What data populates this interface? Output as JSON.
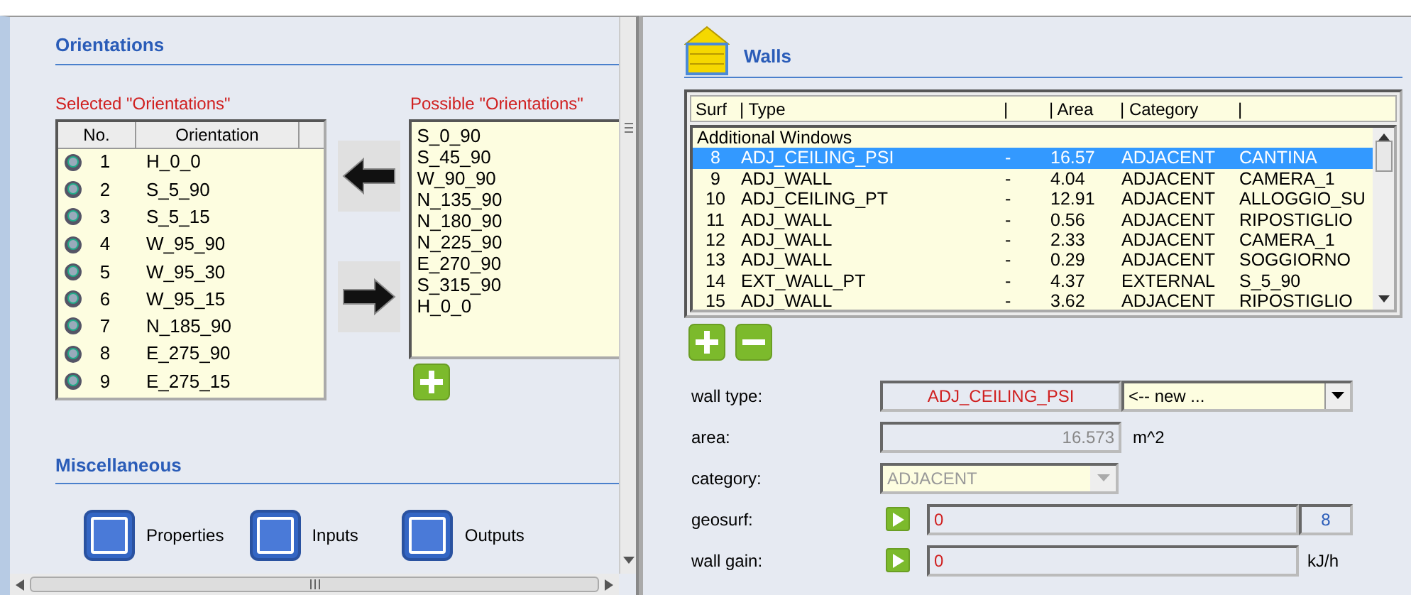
{
  "orientations": {
    "title": "Orientations",
    "selected_label": "Selected \"Orientations\"",
    "possible_label": "Possible \"Orientations\"",
    "columns": [
      "No.",
      "Orientation"
    ],
    "rows": [
      {
        "no": "1",
        "orientation": "H_0_0"
      },
      {
        "no": "2",
        "orientation": "S_5_90"
      },
      {
        "no": "3",
        "orientation": "S_5_15"
      },
      {
        "no": "4",
        "orientation": "W_95_90"
      },
      {
        "no": "5",
        "orientation": "W_95_30"
      },
      {
        "no": "6",
        "orientation": "W_95_15"
      },
      {
        "no": "7",
        "orientation": "N_185_90"
      },
      {
        "no": "8",
        "orientation": "E_275_90"
      },
      {
        "no": "9",
        "orientation": "E_275_15"
      }
    ],
    "possible": [
      "S_0_90",
      "S_45_90",
      "W_90_90",
      "N_135_90",
      "N_180_90",
      "N_225_90",
      "E_270_90",
      "S_315_90",
      "H_0_0"
    ]
  },
  "miscellaneous": {
    "title": "Miscellaneous",
    "buttons": [
      "Properties",
      "Inputs",
      "Outputs"
    ]
  },
  "walls": {
    "title": "Walls",
    "columns": [
      "Surf",
      "| Type",
      "|",
      "| Area",
      "| Category",
      "|"
    ],
    "group": "Additional Windows",
    "rows": [
      {
        "cells": [
          "8",
          "ADJ_CEILING_PSI",
          "-",
          "16.57",
          "ADJACENT",
          "CANTINA"
        ],
        "selected": true
      },
      {
        "cells": [
          "9",
          "ADJ_WALL",
          "-",
          "4.04",
          "ADJACENT",
          "CAMERA_1"
        ],
        "selected": false
      },
      {
        "cells": [
          "10",
          "ADJ_CEILING_PT",
          "-",
          "12.91",
          "ADJACENT",
          "ALLOGGIO_SU"
        ],
        "selected": false
      },
      {
        "cells": [
          "11",
          "ADJ_WALL",
          "-",
          "0.56",
          "ADJACENT",
          "RIPOSTIGLIO"
        ],
        "selected": false
      },
      {
        "cells": [
          "12",
          "ADJ_WALL",
          "-",
          "2.33",
          "ADJACENT",
          "CAMERA_1"
        ],
        "selected": false
      },
      {
        "cells": [
          "13",
          "ADJ_WALL",
          "-",
          "0.29",
          "ADJACENT",
          "SOGGIORNO"
        ],
        "selected": false
      },
      {
        "cells": [
          "14",
          "EXT_WALL_PT",
          "-",
          "4.37",
          "EXTERNAL",
          "S_5_90"
        ],
        "selected": false
      },
      {
        "cells": [
          "15",
          "ADJ_WALL",
          "-",
          "3.62",
          "ADJACENT",
          "RIPOSTIGLIO"
        ],
        "selected": false
      }
    ]
  },
  "form": [
    {
      "kind": "typecombo",
      "label": "wall type:",
      "value": "ADJ_CEILING_PSI",
      "combo": "<-- new ..."
    },
    {
      "kind": "number",
      "label": "area:",
      "value": "16.573",
      "unit": "m^2"
    },
    {
      "kind": "select",
      "label": "category:",
      "value": "ADJACENT",
      "disabled": true
    },
    {
      "kind": "play",
      "label": "geosurf:",
      "value": "0",
      "extra": "8"
    },
    {
      "kind": "play",
      "label": "wall gain:",
      "value": "0",
      "unit": "kJ/h"
    }
  ]
}
